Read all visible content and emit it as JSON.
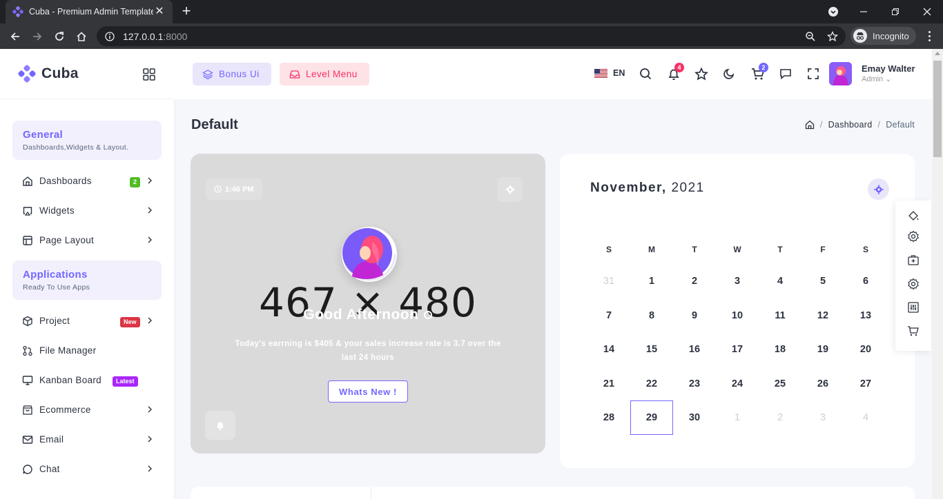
{
  "browser": {
    "tab_title": "Cuba - Premium Admin Template",
    "url_host": "127.0.0.1",
    "url_port": ":8000",
    "profile_label": "Incognito"
  },
  "sidebar": {
    "logo_text": "Cuba",
    "sections": [
      {
        "title": "General",
        "subtitle": "Dashboards,Widgets & Layout."
      },
      {
        "title": "Applications",
        "subtitle": "Ready To Use Apps"
      }
    ],
    "items": [
      {
        "label": "Dashboards",
        "icon": "home-icon",
        "badge": "2",
        "badge_color": "#51bb25"
      },
      {
        "label": "Widgets",
        "icon": "airplay-icon"
      },
      {
        "label": "Page Layout",
        "icon": "layout-icon"
      },
      {
        "label": "Project",
        "icon": "box-icon",
        "badge": "New",
        "badge_color": "#dc3545"
      },
      {
        "label": "File Manager",
        "icon": "git-pull-request-icon"
      },
      {
        "label": "Kanban Board",
        "icon": "monitor-icon",
        "badge": "Latest",
        "badge_color": "#a927f9"
      },
      {
        "label": "Ecommerce",
        "icon": "shopping-bag-icon"
      },
      {
        "label": "Email",
        "icon": "mail-icon"
      },
      {
        "label": "Chat",
        "icon": "message-circle-icon"
      }
    ]
  },
  "header": {
    "bonus_label": "Bonus Ui",
    "level_label": "Level Menu",
    "language": "EN",
    "notification_count": "4",
    "cart_count": "2",
    "user_name": "Emay Walter",
    "user_role": "Admin"
  },
  "page": {
    "title": "Default",
    "breadcrumb": [
      "Dashboard",
      "Default"
    ]
  },
  "welcome": {
    "time": "1:46 PM",
    "placeholder_size": "467 × 480",
    "greeting": "Good Afternoon",
    "message": "Today's earrning is $405 & your sales increase rate is 3.7 over the last 24 hours",
    "button_label": "Whats New !"
  },
  "calendar": {
    "month": "November,",
    "year": "2021",
    "weekdays": [
      "S",
      "M",
      "T",
      "W",
      "T",
      "F",
      "S"
    ],
    "weeks": [
      [
        "31",
        "1",
        "2",
        "3",
        "4",
        "5",
        "6"
      ],
      [
        "7",
        "8",
        "9",
        "10",
        "11",
        "12",
        "13"
      ],
      [
        "14",
        "15",
        "16",
        "17",
        "18",
        "19",
        "20"
      ],
      [
        "21",
        "22",
        "23",
        "24",
        "25",
        "26",
        "27"
      ],
      [
        "28",
        "29",
        "30",
        "1",
        "2",
        "3",
        "4"
      ]
    ],
    "muted": [
      [
        0,
        0
      ],
      [
        4,
        3
      ],
      [
        4,
        4
      ],
      [
        4,
        5
      ],
      [
        4,
        6
      ]
    ],
    "today": [
      4,
      1
    ]
  },
  "colors": {
    "primary": "#7366ff",
    "secondary": "#f73164",
    "success": "#51bb25"
  }
}
